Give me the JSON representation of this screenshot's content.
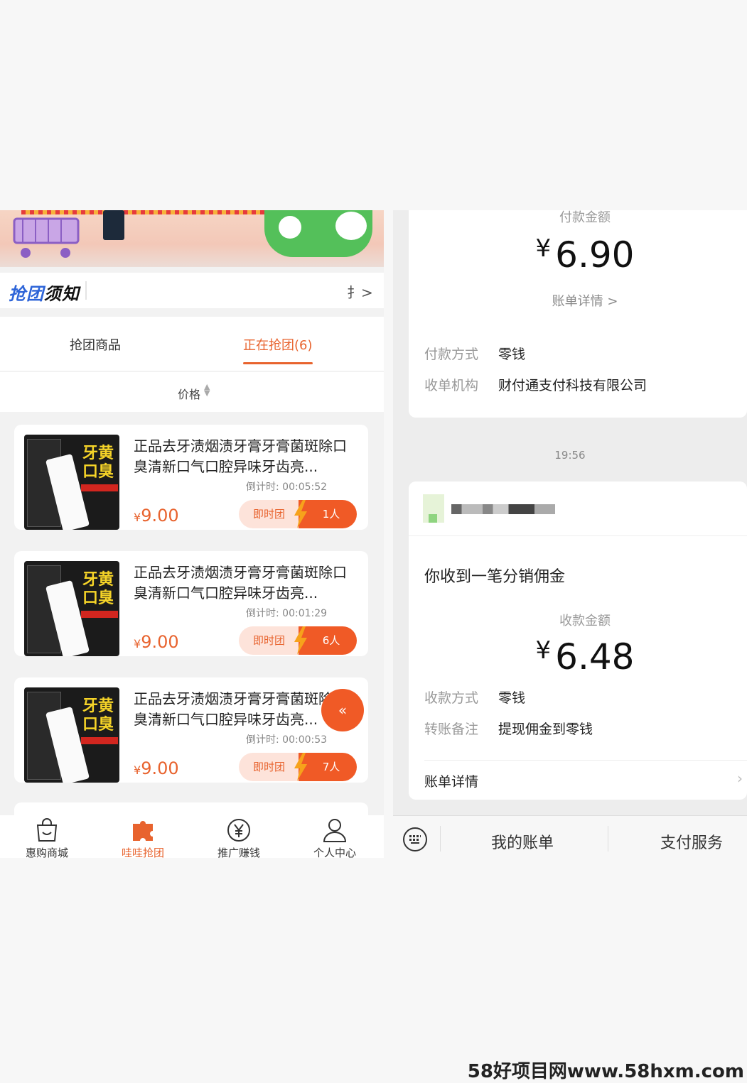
{
  "left": {
    "notice": {
      "title_blue": "抢团",
      "title_black": "须知",
      "right_glyph": "扌>"
    },
    "tabs": [
      {
        "label": "抢团商品"
      },
      {
        "label": "正在抢团(6)"
      }
    ],
    "sort": {
      "label": "价格",
      "icon": "sort-updown-icon"
    },
    "products": [
      {
        "title": "正品去牙渍烟渍牙膏牙膏菌斑除口臭清新口气口腔异味牙齿亮...",
        "countdown": "倒计时:  00:05:52",
        "currency": "¥",
        "price": "9.00",
        "join_label": "即时团",
        "people": "1人"
      },
      {
        "title": "正品去牙渍烟渍牙膏牙膏菌斑除口臭清新口气口腔异味牙齿亮...",
        "countdown": "倒计时:  00:01:29",
        "currency": "¥",
        "price": "9.00",
        "join_label": "即时团",
        "people": "6人"
      },
      {
        "title": "正品去牙渍烟渍牙膏牙膏菌斑除口臭清新口气口腔异味牙齿亮...",
        "countdown": "倒计时:  00:00:53",
        "currency": "¥",
        "price": "9.00",
        "join_label": "即时团",
        "people": "7人"
      }
    ],
    "thumb_text": "牙黄口臭",
    "nav": [
      {
        "label": "惠购商城",
        "icon": "shopping-bag-icon",
        "active": false
      },
      {
        "label": "哇哇抢团",
        "icon": "puzzle-icon",
        "active": true
      },
      {
        "label": "推广赚钱",
        "icon": "yen-coin-icon",
        "active": false
      },
      {
        "label": "个人中心",
        "icon": "person-icon",
        "active": false
      }
    ],
    "accent": "#e8632e"
  },
  "right": {
    "payment": {
      "amount_label": "付款金额",
      "currency": "¥",
      "amount": "6.90",
      "detail_link": "账单详情 >",
      "method_label": "付款方式",
      "method_value": "零钱",
      "merchant_label": "收单机构",
      "merchant_value": "财付通支付科技有限公司"
    },
    "time": "19:56",
    "message": {
      "title": "你收到一笔分销佣金",
      "amount_label": "收款金额",
      "currency": "¥",
      "amount": "6.48",
      "method_label": "收款方式",
      "method_value": "零钱",
      "remark_label": "转账备注",
      "remark_value": "提现佣金到零钱",
      "detail_label": "账单详情"
    },
    "bottom": {
      "account": "我的账单",
      "service": "支付服务"
    }
  },
  "watermark": "58好项目网www.58hxm.com"
}
